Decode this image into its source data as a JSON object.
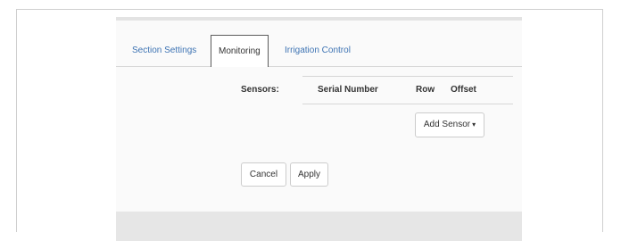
{
  "tabs": [
    {
      "label": "Section Settings",
      "active": false
    },
    {
      "label": "Monitoring",
      "active": true
    },
    {
      "label": "Irrigation Control",
      "active": false
    }
  ],
  "sensors": {
    "label": "Sensors:",
    "columns": [
      "Serial Number",
      "Row",
      "Offset"
    ],
    "rows": [],
    "add_button": "Add Sensor",
    "add_button_caret": "▾"
  },
  "actions": {
    "cancel": "Cancel",
    "apply": "Apply"
  },
  "colors": {
    "link": "#3d73b3",
    "panel_bg": "#fafafa",
    "footer_bg": "#e6e6e6"
  }
}
